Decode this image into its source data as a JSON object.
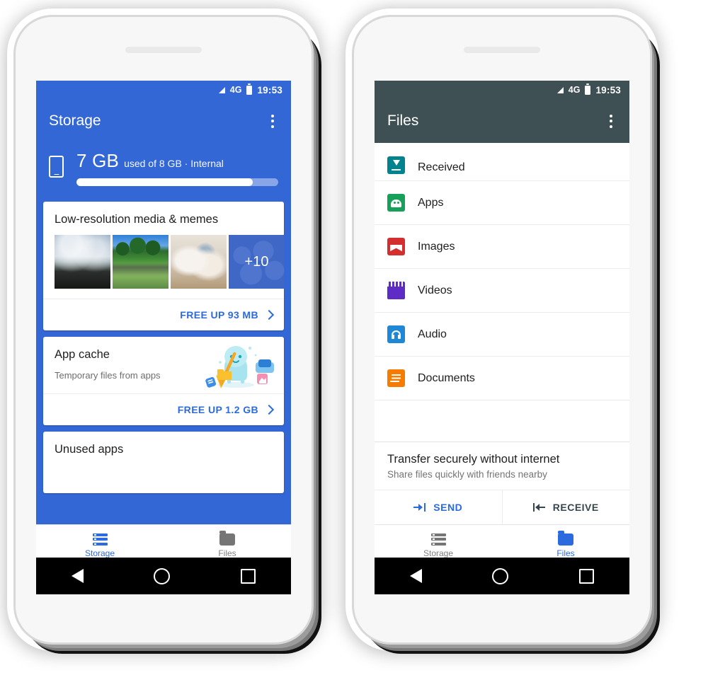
{
  "colors": {
    "storage_blue": "#3367d6",
    "files_header": "#3f5054",
    "accent_blue": "#2c6ae0",
    "receive_dark": "#37474f",
    "received_teal": "#00838f",
    "apps_green": "#17a05a",
    "images_red": "#d32f2f",
    "videos_purple": "#5e2cc4",
    "audio_blue": "#1e88d6",
    "docs_orange": "#f57c00"
  },
  "phones": [
    {
      "id": "storage-phone",
      "status_bar": {
        "network": "4G",
        "time": "19:53",
        "signal_icon": "signal-triangle-icon",
        "battery_icon": "battery-icon"
      },
      "app_bar": {
        "title": "Storage",
        "overflow_icon": "kebab-menu-icon"
      },
      "summary": {
        "device_icon": "phone-icon",
        "used": "7 GB",
        "detail": "used of 8 GB · Internal",
        "progress_percent": 87.5
      },
      "cards": [
        {
          "name": "low-resolution-media-card",
          "title": "Low-resolution media & memes",
          "thumbnails": [
            {
              "name": "thumbnail-beach",
              "style": "t-beach"
            },
            {
              "name": "thumbnail-park-crowd",
              "style": "t-park"
            },
            {
              "name": "thumbnail-cats",
              "style": "t-cats"
            }
          ],
          "more_count": "+10",
          "action_label": "FREE UP 93 MB",
          "action_icon": "chevron-right-icon"
        },
        {
          "name": "app-cache-card",
          "title": "App cache",
          "subtitle": "Temporary files from apps",
          "illustration": "cleaning-mascot-illustration",
          "action_label": "FREE UP 1.2 GB",
          "action_icon": "chevron-right-icon"
        },
        {
          "name": "unused-apps-card",
          "title": "Unused apps"
        }
      ],
      "bottom_nav": [
        {
          "name": "nav-storage",
          "label": "Storage",
          "icon": "storage-bars-icon",
          "active": true
        },
        {
          "name": "nav-files",
          "label": "Files",
          "icon": "folder-icon",
          "active": false
        }
      ],
      "system_nav": {
        "back_icon": "back-triangle-icon",
        "home_icon": "home-circle-icon",
        "recents_icon": "recents-square-icon"
      }
    },
    {
      "id": "files-phone",
      "status_bar": {
        "network": "4G",
        "time": "19:53",
        "signal_icon": "signal-triangle-icon",
        "battery_icon": "battery-icon"
      },
      "app_bar": {
        "title": "Files",
        "overflow_icon": "kebab-menu-icon"
      },
      "file_rows": [
        {
          "name": "file-row-received",
          "label": "Received",
          "icon": "received-download-icon",
          "icon_class": "fic-received",
          "color": "#00838f"
        },
        {
          "name": "file-row-apps",
          "label": "Apps",
          "icon": "android-apps-icon",
          "icon_class": "fic-apps",
          "color": "#17a05a"
        },
        {
          "name": "file-row-images",
          "label": "Images",
          "icon": "image-icon",
          "icon_class": "fic-images",
          "color": "#d32f2f"
        },
        {
          "name": "file-row-videos",
          "label": "Videos",
          "icon": "video-clapper-icon",
          "icon_class": "fic-videos",
          "color": "#5e2cc4"
        },
        {
          "name": "file-row-audio",
          "label": "Audio",
          "icon": "headphones-icon",
          "icon_class": "fic-audio",
          "color": "#1e88d6"
        },
        {
          "name": "file-row-documents",
          "label": "Documents",
          "icon": "document-lines-icon",
          "icon_class": "fic-docs",
          "color": "#f57c00"
        }
      ],
      "transfer": {
        "title": "Transfer securely without internet",
        "subtitle": "Share files quickly with friends nearby",
        "send_label": "SEND",
        "send_icon": "arrow-send-icon",
        "receive_label": "RECEIVE",
        "receive_icon": "arrow-receive-icon"
      },
      "bottom_nav": [
        {
          "name": "nav-storage",
          "label": "Storage",
          "icon": "storage-bars-icon",
          "active": false
        },
        {
          "name": "nav-files",
          "label": "Files",
          "icon": "folder-icon",
          "active": true
        }
      ],
      "system_nav": {
        "back_icon": "back-triangle-icon",
        "home_icon": "home-circle-icon",
        "recents_icon": "recents-square-icon"
      }
    }
  ]
}
